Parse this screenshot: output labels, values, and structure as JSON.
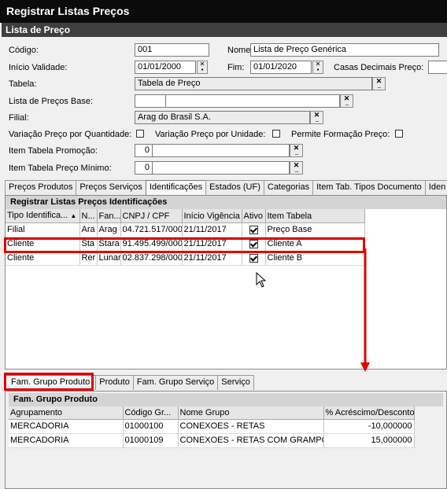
{
  "window": {
    "title": "Registrar Listas Preços"
  },
  "section": {
    "title": "Lista de Preço"
  },
  "form": {
    "codigo_label": "Código:",
    "codigo_value": "001",
    "nome_label": "Nome:",
    "nome_value": "Lista de Preço Genérica",
    "inicio_label": "Início Validade:",
    "inicio_value": "01/01/2000",
    "fim_label": "Fim:",
    "fim_value": "01/01/2020",
    "casas_label": "Casas Decimais Preço:",
    "casas_value": "",
    "tabela_label": "Tabela:",
    "tabela_value": "Tabela de Preço",
    "base_label": "Lista de Preços Base:",
    "base_code": "",
    "base_value": "",
    "filial_label": "Filial:",
    "filial_value": "Arag do Brasil S.A.",
    "var_qtd_label": "Variação Preço por Quantidade:",
    "var_uni_label": "Variação Preço por Unidade:",
    "perm_form_label": "Permite Formação Preço:",
    "promo_label": "Item Tabela Promoção:",
    "promo_num": "0",
    "promo_value": "",
    "minimo_label": "Item Tabela Preço Mínimo:",
    "minimo_num": "0",
    "minimo_value": ""
  },
  "main_tabs": [
    "Preços Produtos",
    "Preços Serviços",
    "Identificações",
    "Estados (UF)",
    "Categorias",
    "Item Tab. Tipos Documento",
    "Iden"
  ],
  "ident": {
    "title": "Registrar Listas Preços Identificações",
    "columns": [
      "Tipo Identifica...",
      "N...",
      "Fan...",
      "CNPJ / CPF",
      "Início Vigência",
      "Ativo",
      "Item Tabela"
    ],
    "rows": [
      [
        "Filial",
        "Ara",
        "Arag",
        "04.721.517/000",
        "21/11/2017",
        "",
        "Preço Base"
      ],
      [
        "Cliente",
        "Sta",
        "Stara",
        "91.495.499/000",
        "21/11/2017",
        "",
        "Cliente A"
      ],
      [
        "Cliente",
        "Rer",
        "Lunar",
        "02.837.298/000",
        "21/11/2017",
        "",
        "Cliente B"
      ]
    ]
  },
  "sub_tabs": [
    "Fam. Grupo Produto",
    "Produto",
    "Fam. Grupo Serviço",
    "Serviço"
  ],
  "fam": {
    "title": "Fam. Grupo Produto",
    "columns": [
      "Agrupamento",
      "Código Gr...",
      "Nome Grupo",
      "% Acréscimo/Desconto"
    ],
    "rows": [
      [
        "MERCADORIA",
        "01000100",
        "CONEXOES - RETAS",
        "-10,000000"
      ],
      [
        "MERCADORIA",
        "01000109",
        "CONEXOES - RETAS COM GRAMPO",
        "15,000000"
      ]
    ]
  },
  "colors": {
    "titlebar": "#0b0b0b",
    "section": "#3f3f3f",
    "highlight": "#e00000"
  }
}
